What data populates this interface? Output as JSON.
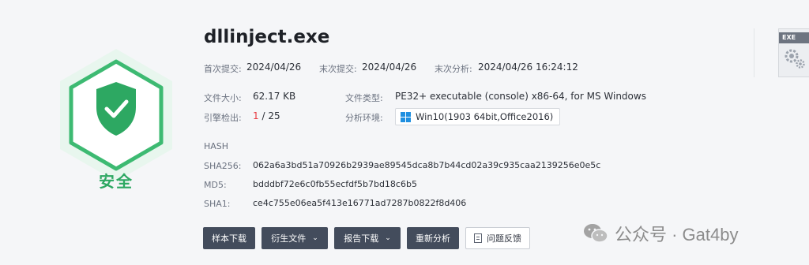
{
  "file": {
    "name": "dllinject.exe",
    "verdict": "安全"
  },
  "dates": {
    "first_submit_label": "首次提交:",
    "first_submit_value": "2024/04/26",
    "last_submit_label": "末次提交:",
    "last_submit_value": "2024/04/26",
    "last_analysis_label": "末次分析:",
    "last_analysis_value": "2024/04/26 16:24:12"
  },
  "details": {
    "size_label": "文件大小:",
    "size_value": "62.17 KB",
    "type_label": "文件类型:",
    "type_value": "PE32+ executable (console) x86-64, for MS Windows",
    "engines_label": "引擎检出:",
    "engines_detected": "1",
    "engines_total": " / 25",
    "env_label": "分析环境:",
    "env_value": "Win10(1903 64bit,Office2016)"
  },
  "hash": {
    "heading": "HASH",
    "sha256_label": "SHA256:",
    "sha256_value": "062a6a3bd51a70926b2939ae89545dca8b7b44cd02a39c935caa2139256e0e5c",
    "md5_label": "MD5:",
    "md5_value": "bdddbf72e6c0fb55ecfdf5b7bd18c6b5",
    "sha1_label": "SHA1:",
    "sha1_value": "ce4c755e06ea5f413e16771ad7287b0822f8d406"
  },
  "actions": {
    "download_sample": "样本下载",
    "derived_files": "衍生文件",
    "download_report": "报告下载",
    "reanalyze": "重新分析",
    "feedback": "问题反馈"
  },
  "exe_card": {
    "tag": "EXE"
  },
  "watermark": {
    "text": "公众号 · Gat4by"
  },
  "colors": {
    "safe_green": "#2da862",
    "button_dark": "#434c5c",
    "detect_red": "#e8393f"
  },
  "icons": [
    "shield-check-icon",
    "windows-icon",
    "chevron-down-icon",
    "document-icon",
    "gear-icon",
    "wechat-icon"
  ]
}
